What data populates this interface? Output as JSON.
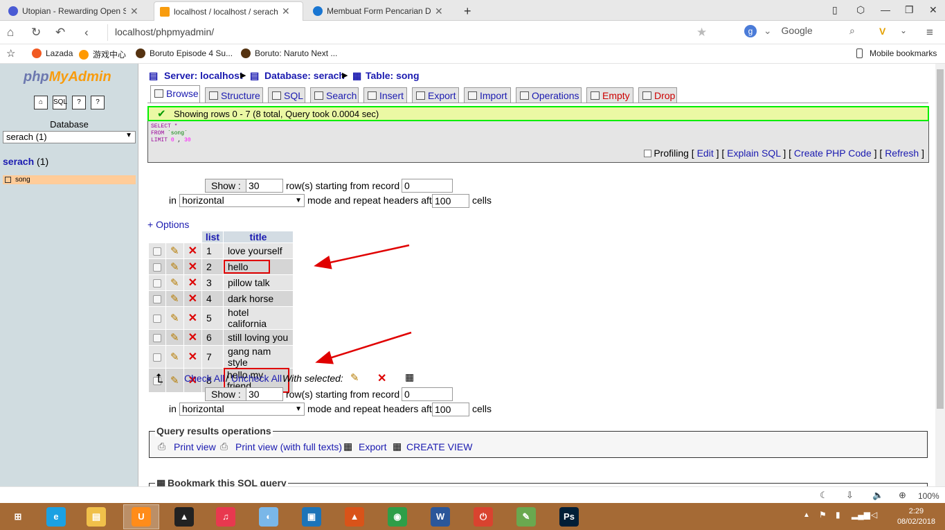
{
  "browser": {
    "tabs": [
      {
        "title": "Utopian - Rewarding Open So",
        "icon_color": "#4a5bd4"
      },
      {
        "title": "localhost / localhost / serach /",
        "icon_color": "#f89c0e"
      },
      {
        "title": "Membuat Form Pencarian Der",
        "icon_color": "#1976d2"
      }
    ],
    "new_tab": "+",
    "address": "localhost/phpmyadmin/",
    "search_engine": "Google",
    "bookmarks": [
      {
        "label": "Lazada",
        "icon_color": "#f15a22"
      },
      {
        "label": "游戏中心",
        "icon_color": "#ff9900"
      },
      {
        "label": "Boruto Episode 4 Su...",
        "icon_color": "#553311"
      },
      {
        "label": "Boruto: Naruto Next ...",
        "icon_color": "#553311"
      }
    ],
    "mobile_bookmarks": "Mobile bookmarks"
  },
  "sidebar": {
    "logo_php": "php",
    "logo_myadmin": "MyAdmin",
    "icons": [
      "home-icon",
      "sql-icon",
      "docs-icon",
      "help-icon"
    ],
    "database_label": "Database",
    "database_select": "serach (1)",
    "db_name": "serach",
    "db_count": "(1)",
    "table_item": "song"
  },
  "breadcrumb": {
    "server": "Server: localhost",
    "database": "Database: serach",
    "table": "Table: song"
  },
  "tabs": [
    "Browse",
    "Structure",
    "SQL",
    "Search",
    "Insert",
    "Export",
    "Import",
    "Operations",
    "Empty",
    "Drop"
  ],
  "message": "Showing rows 0 - 7 (8 total, Query took 0.0004 sec)",
  "sql": {
    "line1_kw": "SELECT",
    "line1_rest": " *",
    "line2_kw": "FROM",
    "line2_rest": " `song`",
    "line3_kw": "LIMIT",
    "line3_a": "0",
    "line3_sep": " , ",
    "line3_b": "30"
  },
  "sql_links": {
    "profiling": "Profiling",
    "edit": "Edit",
    "explain": "Explain SQL",
    "php": "Create PHP Code",
    "refresh": "Refresh"
  },
  "nav": {
    "show_button": "Show :",
    "rows_value": "30",
    "rows_text": "row(s) starting from record #",
    "start_value": "0",
    "in_text": "in",
    "mode_value": "horizontal",
    "mode_text": "mode and repeat headers after",
    "headers_value": "100",
    "cells_text": "cells"
  },
  "options_link": "+ Options",
  "table": {
    "headers": [
      "list",
      "title"
    ],
    "rows": [
      {
        "list": "1",
        "title": "love yourself"
      },
      {
        "list": "2",
        "title": "hello"
      },
      {
        "list": "3",
        "title": "pillow talk"
      },
      {
        "list": "4",
        "title": "dark horse"
      },
      {
        "list": "5",
        "title": "hotel california"
      },
      {
        "list": "6",
        "title": "still loving you"
      },
      {
        "list": "7",
        "title": "gang nam style"
      },
      {
        "list": "8",
        "title": "hello my friend"
      }
    ]
  },
  "with_selected": {
    "check_all": "Check All",
    "slash": "/",
    "uncheck_all": "Uncheck All",
    "label": "With selected:"
  },
  "query_ops": {
    "legend": "Query results operations",
    "print": "Print view",
    "print_full": "Print view (with full texts)",
    "export": "Export",
    "create_view": "CREATE VIEW"
  },
  "bookmark_legend": "Bookmark this SQL query",
  "status": {
    "zoom": "100%"
  },
  "taskbar": {
    "apps": [
      {
        "name": "windows-start",
        "color": "#a56a35",
        "glyph": "⊞"
      },
      {
        "name": "internet-explorer",
        "color": "#1ba1e2",
        "glyph": "e"
      },
      {
        "name": "file-explorer",
        "color": "#f0c04a",
        "glyph": "▤"
      },
      {
        "name": "uc-browser",
        "color": "#ff8c1a",
        "glyph": "U"
      },
      {
        "name": "avast",
        "color": "#222222",
        "glyph": "▲"
      },
      {
        "name": "itunes",
        "color": "#e8384f",
        "glyph": "♫"
      },
      {
        "name": "cleaner",
        "color": "#7ab7e8",
        "glyph": "◐"
      },
      {
        "name": "app-blue",
        "color": "#1c74b8",
        "glyph": "▣"
      },
      {
        "name": "matlab",
        "color": "#d95319",
        "glyph": "▲"
      },
      {
        "name": "chrome",
        "color": "#2e9e48",
        "glyph": "◉"
      },
      {
        "name": "word",
        "color": "#2b579a",
        "glyph": "W"
      },
      {
        "name": "power-app",
        "color": "#d9432f",
        "glyph": "⏻"
      },
      {
        "name": "editor",
        "color": "#6aa84f",
        "glyph": "✎"
      },
      {
        "name": "photoshop",
        "color": "#001e36",
        "glyph": "Ps"
      }
    ],
    "time": "2:29",
    "date": "08/02/2018"
  }
}
